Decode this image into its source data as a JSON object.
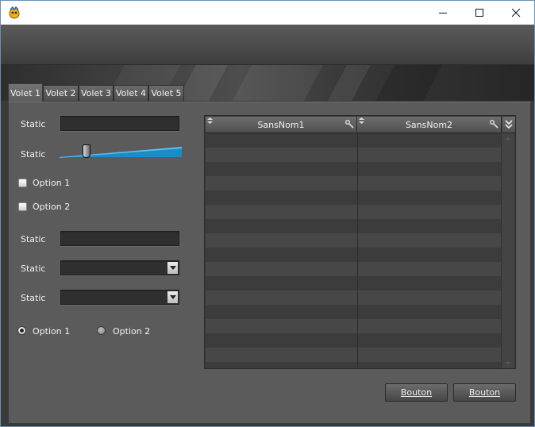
{
  "window": {
    "app_icon": "windev-app-icon",
    "controls": [
      "minimize-icon",
      "maximize-icon",
      "close-icon"
    ]
  },
  "tabs": [
    "Volet 1",
    "Volet 2",
    "Volet 3",
    "Volet 4",
    "Volet 5"
  ],
  "active_tab": "Volet 1",
  "form": {
    "static_1": "Static",
    "slider_label": "Static",
    "slider_value": 0.22,
    "checkbox_1": "Option 1",
    "checkbox_2": "Option 2",
    "static_2": "Static",
    "combo_label_1": "Static",
    "combo_label_2": "Static",
    "radio_1": "Option 1",
    "radio_2": "Option 2",
    "radio_selected": "Option 1"
  },
  "table": {
    "columns": [
      "SansNom1",
      "SansNom2"
    ]
  },
  "buttons": {
    "bouton_1": "Bouton",
    "bouton_2": "Bouton"
  },
  "colors": {
    "slider_accent": "#1a8cc7",
    "panel_bg": "#5b5b5b",
    "table_bg": "#3c3c3c"
  }
}
